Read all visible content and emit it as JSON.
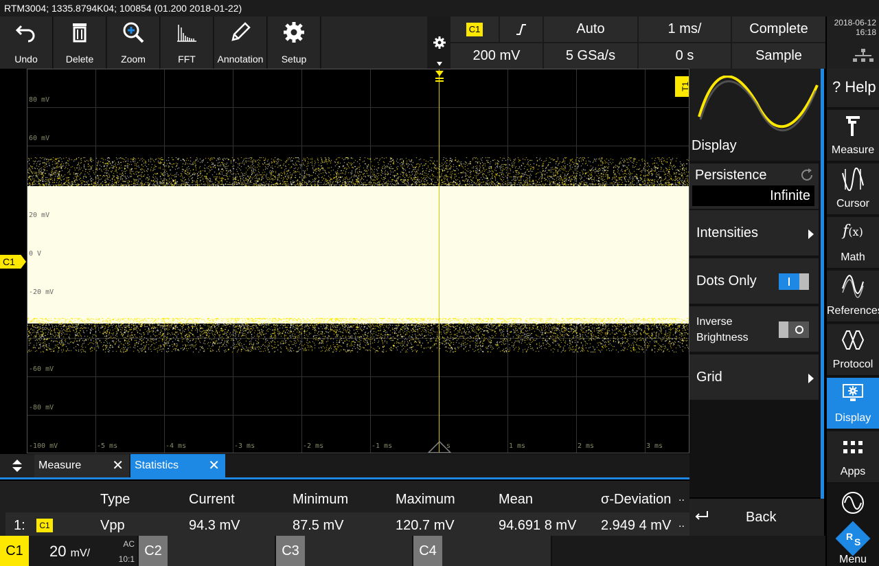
{
  "title": "RTM3004; 1335.8794K04; 100854 (01.200 2018-01-22)",
  "toolbar": {
    "undo": "Undo",
    "delete": "Delete",
    "zoom": "Zoom",
    "fft": "FFT",
    "annotation": "Annotation",
    "setup": "Setup"
  },
  "settings": {
    "trigger_source": "C1",
    "trigger_mode": "Auto",
    "time_scale": "1 ms/",
    "acquisition_state": "Complete",
    "trigger_level": "200 mV",
    "sample_rate": "5 GSa/s",
    "time_offset": "0 s",
    "acquisition_mode": "Sample"
  },
  "datetime": {
    "date": "2018-06-12",
    "time": "16:18"
  },
  "plot": {
    "y_labels": [
      "80 mV",
      "60 mV",
      "20 mV",
      "0 V",
      "-20 mV",
      "-60 mV",
      "-80 mV",
      "-100 mV"
    ],
    "x_labels": [
      "-5 ms",
      "-4 ms",
      "-3 ms",
      "-2 ms",
      "-1 ms",
      "s",
      "1 ms",
      "2 ms",
      "3 ms"
    ],
    "trigger_marker": "T1",
    "channel_marker": "C1",
    "trace_color": "#ffe800"
  },
  "panel": {
    "header_label": "Display",
    "persistence_label": "Persistence",
    "persistence_value": "Infinite",
    "intensities": "Intensities",
    "dots_only": "Dots Only",
    "dots_only_on": true,
    "inverse_brightness_1": "Inverse",
    "inverse_brightness_2": "Brightness",
    "inverse_brightness_on": false,
    "grid": "Grid",
    "back": "Back"
  },
  "nav": {
    "help": "Help",
    "measure": "Measure",
    "cursor": "Cursor",
    "math": "Math",
    "references": "References",
    "protocol": "Protocol",
    "display": "Display",
    "apps": "Apps",
    "menu": "Menu",
    "active": "Display",
    "accent": "#1e88e5"
  },
  "tabs": {
    "measure": "Measure",
    "statistics": "Statistics"
  },
  "stats": {
    "headers": [
      "Type",
      "Current",
      "Minimum",
      "Maximum",
      "Mean",
      "σ-Deviation",
      ".."
    ],
    "row": {
      "index": "1:",
      "channel": "C1",
      "type": "Vpp",
      "current": "94.3 mV",
      "minimum": "87.5 mV",
      "maximum": "120.7 mV",
      "mean": "94.691 8 mV",
      "sigma": "2.949 4 mV",
      "more": ".."
    }
  },
  "channels": {
    "c1_label": "C1",
    "c1_scale": "20",
    "c1_unit": "mV/",
    "c1_coupling": "AC",
    "c1_probe": "10:1",
    "c2_label": "C2",
    "c3_label": "C3",
    "c4_label": "C4"
  }
}
